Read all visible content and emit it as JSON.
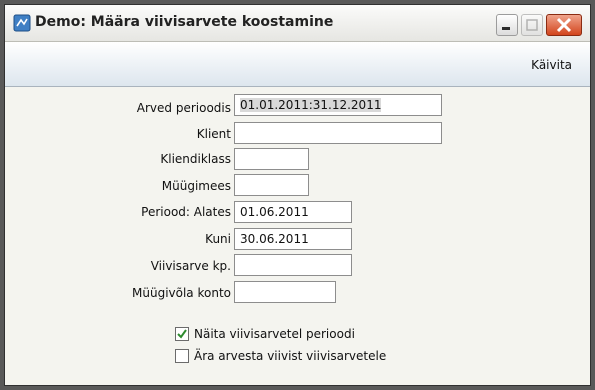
{
  "window": {
    "title": "Demo: Määra viivisarvete koostamine",
    "controls": {
      "minimize_icon": "minimize-icon",
      "maximize_icon": "maximize-icon",
      "close_icon": "close-icon"
    }
  },
  "toolbar": {
    "run_label": "Käivita"
  },
  "form": {
    "arved_perioodis": {
      "label": "Arved perioodis",
      "value": "01.01.2011:31.12.2011"
    },
    "klient": {
      "label": "Klient",
      "value": ""
    },
    "kliendiklass": {
      "label": "Kliendiklass",
      "value": ""
    },
    "myygimees": {
      "label": "Müügimees",
      "value": ""
    },
    "periood_alates": {
      "label": "Periood: Alates",
      "value": "01.06.2011"
    },
    "kuni": {
      "label": "Kuni",
      "value": "30.06.2011"
    },
    "viivisarve_kp": {
      "label": "Viivisarve kp.",
      "value": ""
    },
    "myygivola_konto": {
      "label": "Müügivõla konto",
      "value": ""
    }
  },
  "options": {
    "naita_viivisarvetel_perioodi": {
      "label": "Näita viivisarvetel perioodi",
      "checked": true
    },
    "ara_arvesta_viivist": {
      "label": "Ära arvesta viivist viivisarvetele",
      "checked": false
    }
  },
  "colors": {
    "checkmark": "#2e8b2e",
    "close_button": "#d2451d",
    "toolbar_bottom": "#dde6ee"
  }
}
